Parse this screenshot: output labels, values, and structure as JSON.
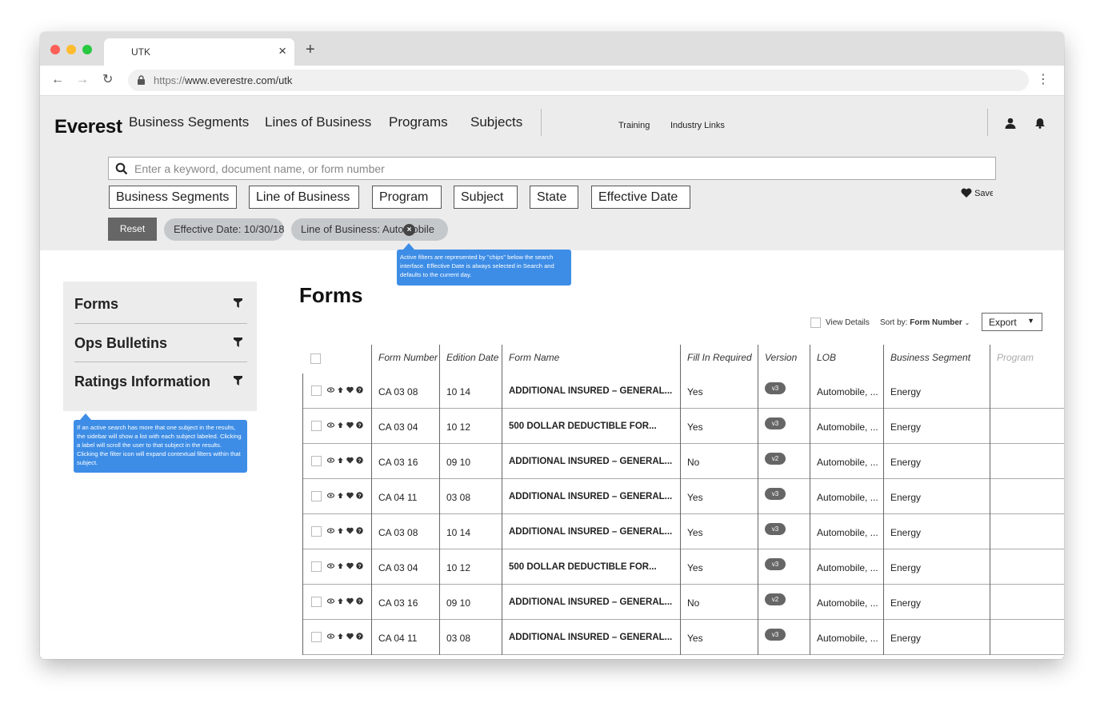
{
  "browser": {
    "tab_title": "UTK",
    "url_scheme": "https://",
    "url_rest": "www.everestre.com/utk"
  },
  "header": {
    "logo": "Everest",
    "nav": [
      "Business Segments",
      "Lines of Business",
      "Programs",
      "Subjects"
    ],
    "links": [
      "Training",
      "Industry Links"
    ]
  },
  "search": {
    "placeholder": "Enter a keyword, document name, or form number",
    "filters": [
      "Business Segments",
      "Line of Business",
      "Program",
      "Subject",
      "State",
      "Effective Date"
    ],
    "save_label": "Save",
    "reset_label": "Reset",
    "chips": [
      "Effective Date: 10/30/18",
      "Line of Business: Automobile"
    ]
  },
  "tooltips": {
    "chips": "Active filters are represented by \"chips\" below the search interface. Effective Date is always selected in Search and defaults to the current day.",
    "sidebar": "If an active search has more that one subject in the results, the sidebar will show a list with each subject labeled. Clicking a label will scroll the user to that subject in the results. Clicking the filter icon will expand contextual filters within that subject."
  },
  "sidebar": {
    "items": [
      "Forms",
      "Ops Bulletins",
      "Ratings Information"
    ]
  },
  "main": {
    "title": "Forms",
    "view_details": "View Details",
    "sort_label": "Sort by:",
    "sort_value": "Form Number",
    "export_label": "Export"
  },
  "table": {
    "columns": [
      "Form Number",
      "Edition Date",
      "Form Name",
      "Fill In Required",
      "Version",
      "LOB",
      "Business Segment",
      "Program"
    ],
    "rows": [
      {
        "form_number": "CA 03 08",
        "edition": "10 14",
        "name": "ADDITIONAL INSURED – GENERAL...",
        "fill": "Yes",
        "version": "v3",
        "lob": "Automobile, ...",
        "segment": "Energy"
      },
      {
        "form_number": "CA 03 04",
        "edition": "10 12",
        "name": "500 DOLLAR DEDUCTIBLE FOR...",
        "fill": "Yes",
        "version": "v3",
        "lob": "Automobile, ...",
        "segment": "Energy"
      },
      {
        "form_number": "CA 03 16",
        "edition": "09 10",
        "name": "ADDITIONAL INSURED – GENERAL...",
        "fill": "No",
        "version": "v2",
        "lob": "Automobile, ...",
        "segment": "Energy"
      },
      {
        "form_number": "CA 04 11",
        "edition": "03 08",
        "name": "ADDITIONAL INSURED – GENERAL...",
        "fill": "Yes",
        "version": "v3",
        "lob": "Automobile, ...",
        "segment": "Energy"
      },
      {
        "form_number": "CA 03 08",
        "edition": "10 14",
        "name": "ADDITIONAL INSURED – GENERAL...",
        "fill": "Yes",
        "version": "v3",
        "lob": "Automobile, ...",
        "segment": "Energy"
      },
      {
        "form_number": "CA 03 04",
        "edition": "10 12",
        "name": "500 DOLLAR DEDUCTIBLE FOR...",
        "fill": "Yes",
        "version": "v3",
        "lob": "Automobile, ...",
        "segment": "Energy"
      },
      {
        "form_number": "CA 03 16",
        "edition": "09 10",
        "name": "ADDITIONAL INSURED – GENERAL...",
        "fill": "No",
        "version": "v2",
        "lob": "Automobile, ...",
        "segment": "Energy"
      },
      {
        "form_number": "CA 04 11",
        "edition": "03 08",
        "name": "ADDITIONAL INSURED – GENERAL...",
        "fill": "Yes",
        "version": "v3",
        "lob": "Automobile, ...",
        "segment": "Energy"
      }
    ]
  }
}
